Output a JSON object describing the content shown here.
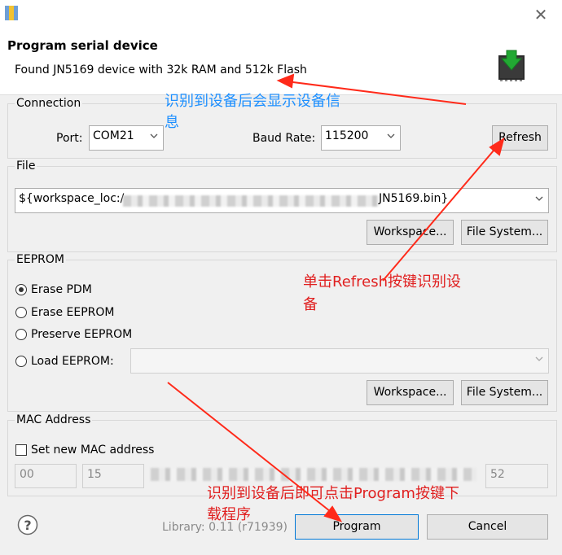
{
  "dialog": {
    "title": "Program serial device",
    "message": "Found JN5169 device with 32k RAM and 512k Flash"
  },
  "connection": {
    "legend": "Connection",
    "port_label": "Port:",
    "port_value": "COM21",
    "baud_label": "Baud Rate:",
    "baud_value": "115200",
    "refresh_label": "Refresh"
  },
  "file": {
    "legend": "File",
    "path_start": "${workspace_loc:/",
    "path_end": "JN5169.bin}",
    "workspace_label": "Workspace...",
    "filesystem_label": "File System..."
  },
  "eeprom": {
    "legend": "EEPROM",
    "options": [
      "Erase PDM",
      "Erase EEPROM",
      "Preserve EEPROM",
      "Load EEPROM:"
    ],
    "selected": "Erase PDM",
    "workspace_label": "Workspace...",
    "filesystem_label": "File System..."
  },
  "mac": {
    "legend": "MAC Address",
    "checkbox_label": "Set new MAC address",
    "fields": [
      "00",
      "15",
      "52"
    ]
  },
  "footer": {
    "help_symbol": "?",
    "library": "Library: 0.11 (r71939)",
    "program_label": "Program",
    "cancel_label": "Cancel"
  },
  "annotations": {
    "a1_line1": "识别到设备后会显示设备信",
    "a1_line2": "息",
    "a2_line1": "单击Refresh按键识别设",
    "a2_line2": "备",
    "a3_line1": "识别到设备后即可点击Program按键下",
    "a3_line2": "载程序"
  },
  "colors": {
    "annotation_blue": "#1e90ff",
    "annotation_red": "#e02020",
    "arrow_red": "#ff2a1a",
    "accent": "#0078d7"
  },
  "icons": [
    "app-icon",
    "close-icon",
    "chip-download-icon",
    "chevron-down-icon",
    "help-icon"
  ]
}
